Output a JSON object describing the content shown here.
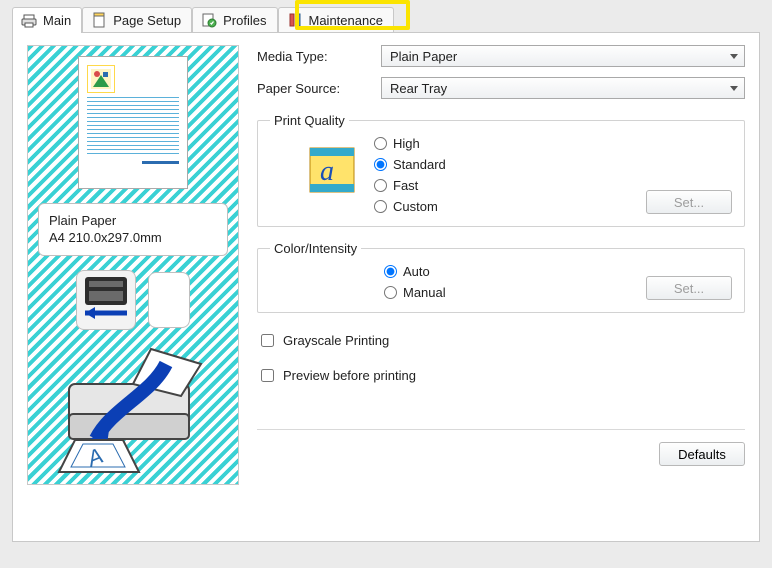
{
  "tabs": {
    "main": "Main",
    "page_setup": "Page Setup",
    "profiles": "Profiles",
    "maintenance": "Maintenance"
  },
  "preview_info": {
    "line1": "Plain Paper",
    "line2": "A4 210.0x297.0mm"
  },
  "form": {
    "media_type_label": "Media Type:",
    "media_type_value": "Plain Paper",
    "paper_source_label": "Paper Source:",
    "paper_source_value": "Rear Tray"
  },
  "print_quality": {
    "legend": "Print Quality",
    "high": "High",
    "standard": "Standard",
    "fast": "Fast",
    "custom": "Custom",
    "set": "Set..."
  },
  "color_intensity": {
    "legend": "Color/Intensity",
    "auto": "Auto",
    "manual": "Manual",
    "set": "Set..."
  },
  "checks": {
    "grayscale": "Grayscale Printing",
    "preview": "Preview before printing"
  },
  "footer": {
    "defaults": "Defaults"
  }
}
